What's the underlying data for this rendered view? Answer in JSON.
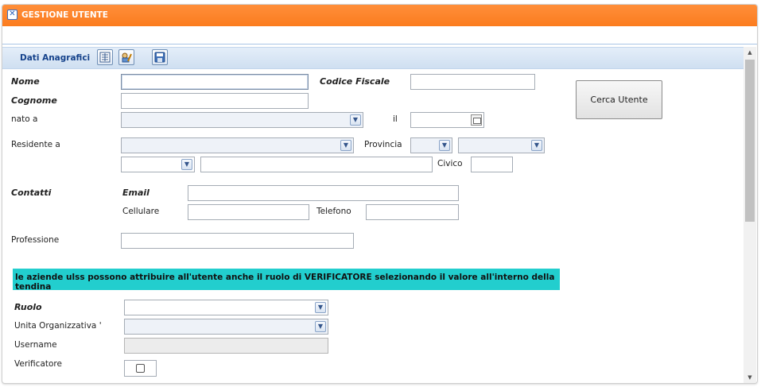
{
  "window": {
    "title": "GESTIONE UTENTE"
  },
  "section": {
    "title": "Dati Anagrafici"
  },
  "labels": {
    "nome": "Nome",
    "codice_fiscale": "Codice Fiscale",
    "cognome": "Cognome",
    "nato_a": "nato a",
    "il": "il",
    "residente_a": "Residente a",
    "provincia": "Provincia",
    "civico": "Civico",
    "contatti": "Contatti",
    "email": "Email",
    "cellulare": "Cellulare",
    "telefono": "Telefono",
    "professione": "Professione",
    "ruolo": "Ruolo",
    "unita_organizzativa": "Unita Organizzativa '",
    "username": "Username",
    "verificatore": "Verificatore"
  },
  "buttons": {
    "cerca_utente": "Cerca Utente"
  },
  "banner": "le aziende ulss possono attribuire all'utente anche il ruolo di VERIFICATORE selezionando il valore all'interno della tendina",
  "values": {
    "nome": "",
    "codice_fiscale": "",
    "cognome": "",
    "nato_a": "",
    "data_nascita": "",
    "residente_a": "",
    "provincia": "",
    "comune": "",
    "tipo_via": "",
    "indirizzo": "",
    "civico": "",
    "email": "",
    "cellulare": "",
    "telefono": "",
    "professione": "",
    "ruolo": "",
    "unita_organizzativa": "",
    "username": "",
    "verificatore": false
  },
  "icons": {
    "close": "close-icon",
    "list": "list-icon",
    "edit": "edit-user-icon",
    "save": "floppy-save-icon",
    "dropdown": "chevron-down-icon",
    "calendar": "calendar-icon"
  },
  "colors": {
    "titlebar": "#fb7c1e",
    "section_text": "#15428b",
    "banner": "#22cece"
  }
}
